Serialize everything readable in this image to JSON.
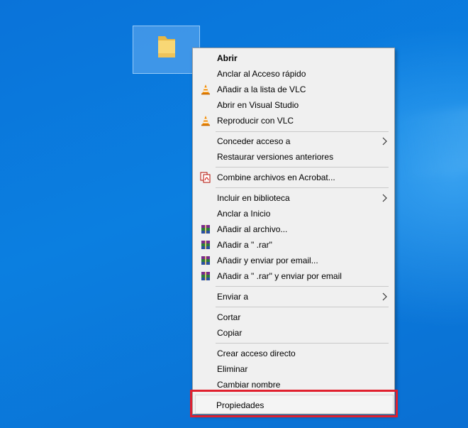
{
  "desktop": {
    "folder_icon": "folder-icon"
  },
  "menu": {
    "items": {
      "abrir": "Abrir",
      "anclar_acceso": "Anclar al Acceso rápido",
      "vlc_lista": "Añadir a la lista de VLC",
      "visual_studio": "Abrir en Visual Studio",
      "vlc_reproducir": "Reproducir con VLC",
      "conceder": "Conceder acceso a",
      "restaurar": "Restaurar versiones anteriores",
      "acrobat": "Combine archivos en Acrobat...",
      "biblioteca": "Incluir en biblioteca",
      "anclar_inicio": "Anclar a Inicio",
      "rar_archivo": "Añadir al archivo...",
      "rar_add": "Añadir a \" .rar\"",
      "rar_email": "Añadir y enviar por email...",
      "rar_add_email": "Añadir a \" .rar\" y enviar por email",
      "enviar": "Enviar a",
      "cortar": "Cortar",
      "copiar": "Copiar",
      "acceso_directo": "Crear acceso directo",
      "eliminar": "Eliminar",
      "cambiar_nombre": "Cambiar nombre",
      "propiedades": "Propiedades"
    },
    "icons": {
      "vlc": "vlc-cone-icon",
      "acrobat": "acrobat-combine-icon",
      "winrar": "winrar-books-icon",
      "submenu": "chevron-right-icon"
    }
  },
  "colors": {
    "desktop_blue": "#0b7fe0",
    "menu_bg": "#f0f0f0",
    "highlight_red": "#e0202e"
  }
}
